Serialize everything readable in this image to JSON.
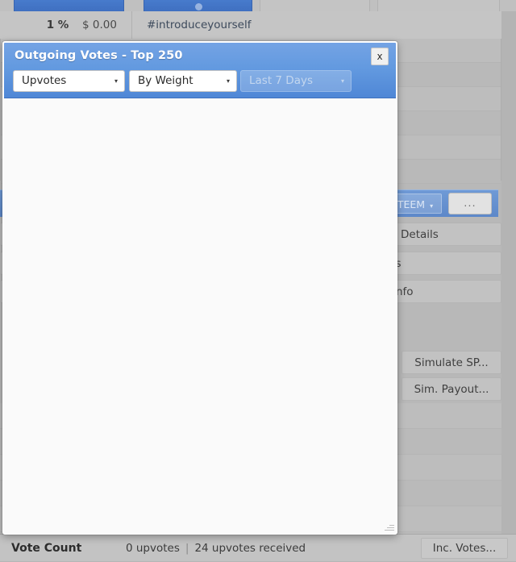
{
  "background": {
    "toolbar": {
      "button_1_label": "",
      "button_2_label": "",
      "button_3_label": "",
      "button_4_label": ""
    },
    "row": {
      "percent": "1 %",
      "amount": "$ 0.00",
      "tag": "#introduceyourself"
    },
    "selected_row": {
      "currency": "STEEM",
      "caret": "▾",
      "more_label": "..."
    },
    "right_buttons": {
      "details": "Details",
      "members": "rs",
      "info": "Info",
      "simulate_sp": "Simulate SP...",
      "sim_payout": "Sim. Payout..."
    }
  },
  "status_bar": {
    "label": "Vote Count",
    "outgoing": "0 upvotes",
    "separator": "|",
    "received": "24 upvotes received",
    "button": "Inc. Votes..."
  },
  "dialog": {
    "title": "Outgoing Votes - Top 250",
    "close_label": "x",
    "filters": {
      "vote_type": {
        "value": "Upvotes",
        "caret": "▾"
      },
      "sort_by": {
        "value": "By Weight",
        "caret": "▾"
      },
      "period": {
        "value": "Last 7 Days",
        "caret": "▾",
        "disabled": true
      }
    },
    "body_content": ""
  },
  "colors": {
    "accent_blue": "#639ae0",
    "header_blue_top": "#74a3e4",
    "header_blue_bottom": "#4f87d6",
    "window_gray": "#b8b8b8",
    "panel_gray": "#c3c3c3",
    "dialog_body": "#fafafa",
    "tag_link": "#3d4a5c"
  }
}
